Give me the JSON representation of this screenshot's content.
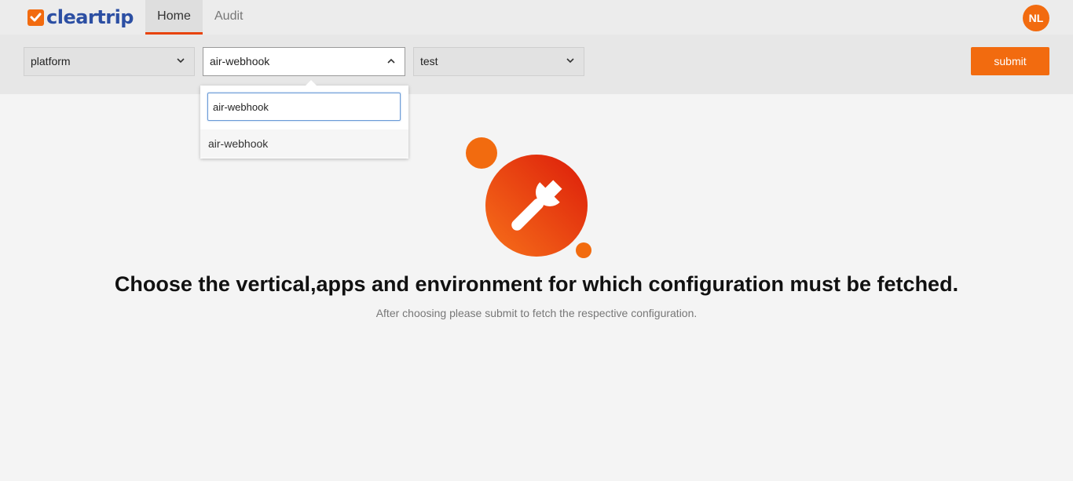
{
  "brand": {
    "name": "cleartrip",
    "accent": "#f26b0f",
    "logo_text_color": "#2c4fa3"
  },
  "nav": {
    "tabs": [
      {
        "label": "Home",
        "active": true
      },
      {
        "label": "Audit",
        "active": false
      }
    ]
  },
  "user": {
    "initials": "NL"
  },
  "filters": {
    "vertical": {
      "value": "platform",
      "icon": "chevron-down-icon"
    },
    "app": {
      "value": "air-webhook",
      "icon": "chevron-up-icon",
      "open": true
    },
    "environment": {
      "value": "test",
      "icon": "chevron-down-icon"
    },
    "submit_label": "submit"
  },
  "dropdown": {
    "search_value": "air-webhook",
    "options": [
      "air-webhook"
    ]
  },
  "empty_state": {
    "icon": "wrench-icon",
    "headline": "Choose the vertical,apps and environment for which configuration must be fetched.",
    "subline": "After choosing please submit to fetch the respective configuration."
  }
}
